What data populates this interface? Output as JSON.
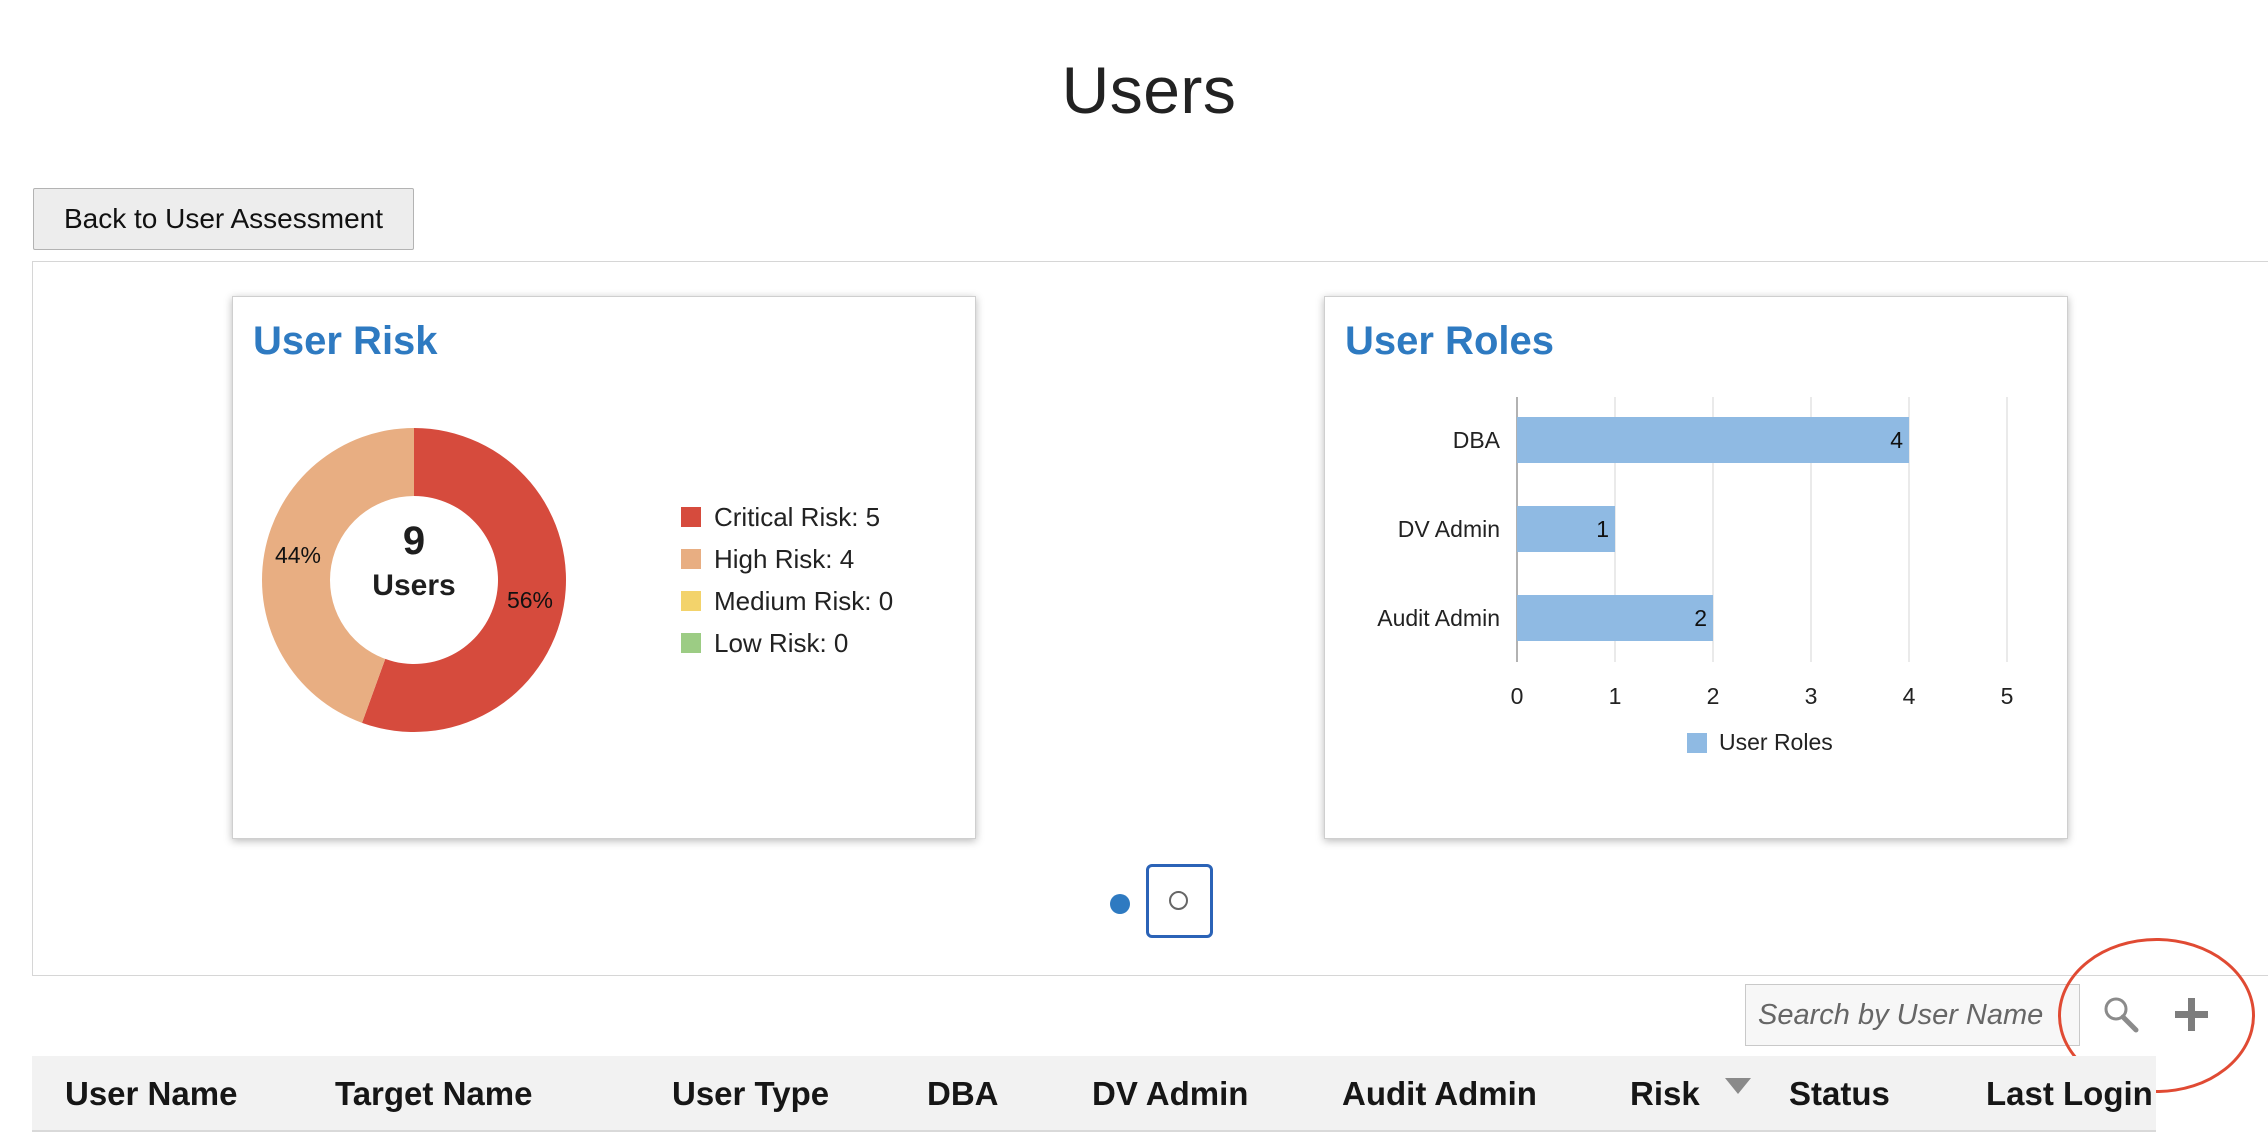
{
  "page": {
    "title": "Users"
  },
  "back_button": {
    "label": "Back to User Assessment"
  },
  "user_risk_card": {
    "title": "User Risk",
    "center_value": "9",
    "center_label": "Users",
    "slice_labels": [
      "56%",
      "44%"
    ],
    "legend": [
      {
        "label": "Critical Risk: 5",
        "color": "#d64b3d"
      },
      {
        "label": "High Risk: 4",
        "color": "#e8ae82"
      },
      {
        "label": "Medium Risk: 0",
        "color": "#f3d36b"
      },
      {
        "label": "Low Risk: 0",
        "color": "#9ccc84"
      }
    ]
  },
  "user_roles_card": {
    "title": "User Roles"
  },
  "carousel": {
    "page_count": 2,
    "active_page": 1
  },
  "search": {
    "placeholder": "Search by User Name",
    "value": "",
    "search_icon": "search-icon",
    "add_icon": "plus-icon"
  },
  "table": {
    "columns": [
      "User Name",
      "Target Name",
      "User Type",
      "DBA",
      "DV Admin",
      "Audit Admin",
      "Risk",
      "Status",
      "Last Login"
    ],
    "sorted_column": "Risk",
    "sort_direction": "descending"
  },
  "colors": {
    "accent": "#2e7ac1",
    "annotation": "#e04a33",
    "bar": "#8fbae3"
  },
  "chart_data": [
    {
      "type": "pie",
      "title": "User Risk",
      "categories": [
        "Critical Risk",
        "High Risk",
        "Medium Risk",
        "Low Risk"
      ],
      "values": [
        5,
        4,
        0,
        0
      ],
      "colors": [
        "#d64b3d",
        "#e8ae82",
        "#f3d36b",
        "#9ccc84"
      ],
      "donut": true,
      "center_text": "9 Users",
      "legend": "right"
    },
    {
      "type": "bar",
      "orientation": "horizontal",
      "title": "User Roles",
      "categories": [
        "DBA",
        "DV Admin",
        "Audit Admin"
      ],
      "series": [
        {
          "name": "User Roles",
          "values": [
            4,
            1,
            2
          ]
        }
      ],
      "xlim": [
        0,
        5
      ],
      "xticks": [
        "0",
        "1",
        "2",
        "3",
        "4",
        "5"
      ],
      "grid": true,
      "legend": "bottom",
      "data_labels": true,
      "color": "#8fbae3"
    }
  ]
}
